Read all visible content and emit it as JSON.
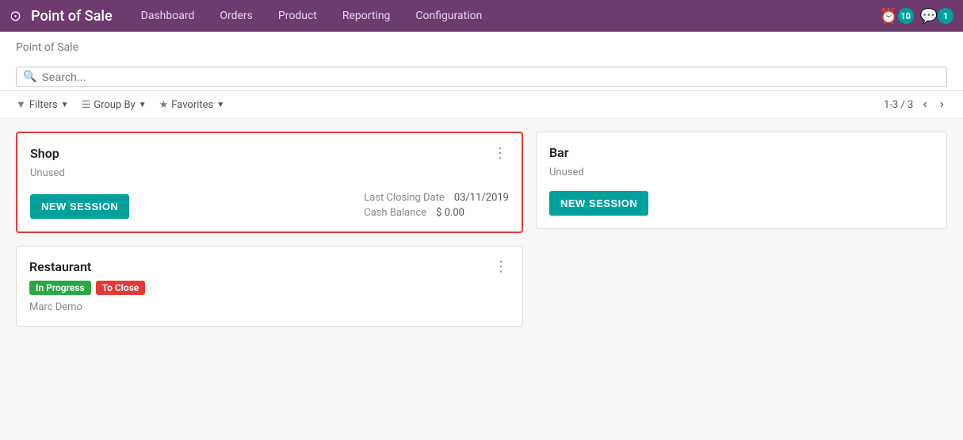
{
  "topnav": {
    "title": "Point of Sale",
    "menu_items": [
      "Dashboard",
      "Orders",
      "Product",
      "Reporting",
      "Configuration"
    ],
    "badge_count": "10",
    "message_count": "1"
  },
  "breadcrumb": {
    "text": "Point of Sale"
  },
  "search": {
    "placeholder": "Search..."
  },
  "filterbar": {
    "filters_label": "Filters",
    "groupby_label": "Group By",
    "favorites_label": "Favorites",
    "pagination": "1-3 / 3"
  },
  "cards": {
    "shop": {
      "title": "Shop",
      "subtitle": "Unused",
      "btn_label": "NEW SESSION",
      "last_closing_label": "Last Closing Date",
      "last_closing_value": "03/11/2019",
      "cash_balance_label": "Cash Balance",
      "cash_balance_value": "$ 0.00"
    },
    "restaurant": {
      "title": "Restaurant",
      "badge_in_progress": "In Progress",
      "badge_to_close": "To Close",
      "user": "Marc Demo"
    },
    "bar": {
      "title": "Bar",
      "subtitle": "Unused",
      "btn_label": "NEW SESSION"
    }
  }
}
